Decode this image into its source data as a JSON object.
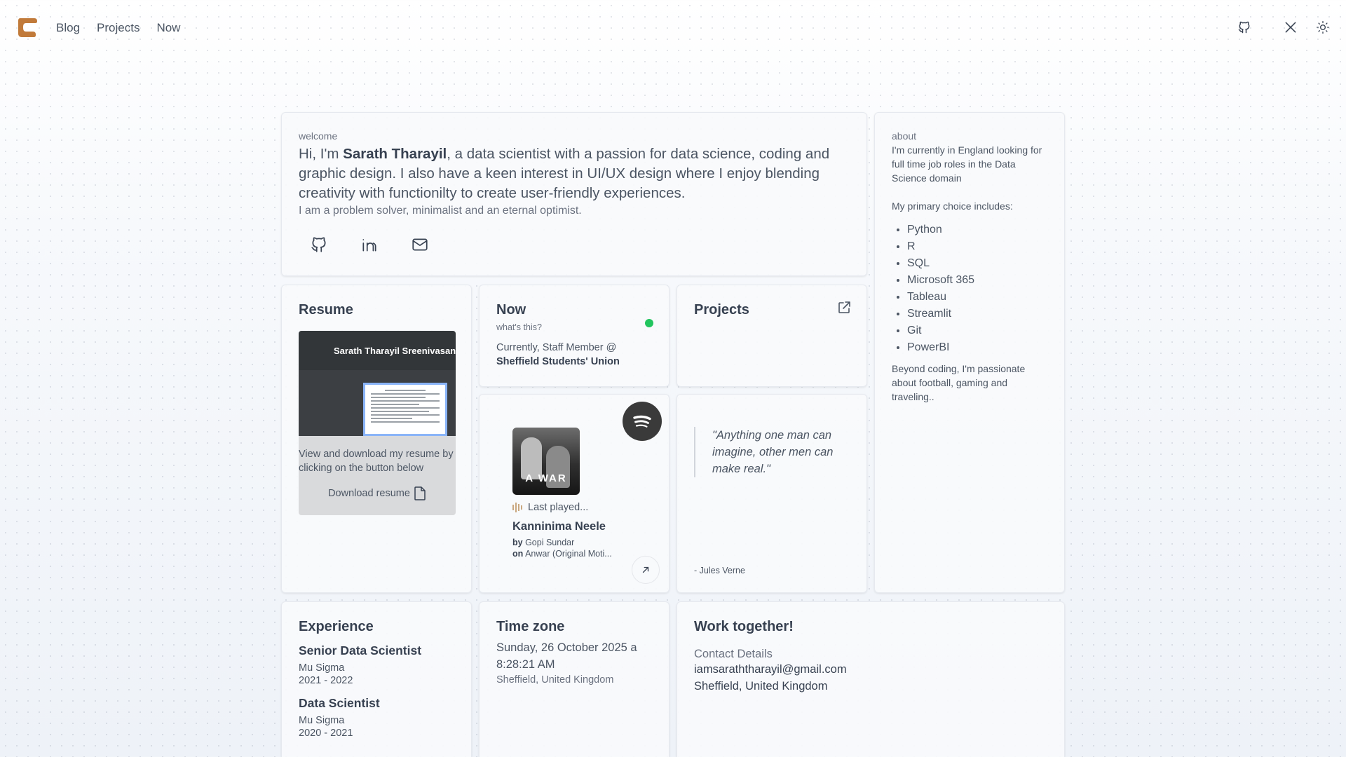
{
  "nav": {
    "links": [
      "Blog",
      "Projects",
      "Now"
    ],
    "icons": [
      "github-icon",
      "x-icon",
      "sun-icon"
    ]
  },
  "welcome": {
    "label": "welcome",
    "intro_prefix": "Hi, I'm ",
    "name": "Sarath Tharayil",
    "intro_rest": ", a data scientist with a passion for data science, coding and graphic design. I also have a keen interest in UI/UX design where I enjoy blending creativity with functionilty to create user-friendly experiences.",
    "tagline": "I am a problem solver, minimalist and an eternal optimist.",
    "icons": [
      "github-icon",
      "linkedin-icon",
      "mail-icon"
    ]
  },
  "about": {
    "label": "about",
    "text": "I'm currently in England looking for full time job roles in the Data Science domain",
    "choice_label": "My primary choice includes:",
    "skills": [
      "Python",
      "R",
      "SQL",
      "Microsoft 365",
      "Tableau",
      "Streamlit",
      "Git",
      "PowerBI"
    ],
    "outro": "Beyond coding, I'm passionate about football, gaming and traveling.."
  },
  "resume": {
    "title": "Resume",
    "viewer_filename": "Sarath Tharayil Sreenivasan",
    "description": "View and download my resume by clicking on the button below",
    "download_label": "Download resume"
  },
  "now": {
    "title": "Now",
    "link": "what's this?",
    "status_prefix": "Currently, Staff Member @",
    "status_org": "Sheffield Students' Union",
    "status_color": "#22c55e"
  },
  "projects": {
    "title": "Projects"
  },
  "spotify": {
    "album_text": "A WAR",
    "last_played": "Last played...",
    "track": "Kanninima Neele",
    "by_label": "by",
    "artist": "Gopi Sundar",
    "on_label": "on",
    "album": "Anwar (Original Moti..."
  },
  "quote": {
    "text": "\"Anything one man can imagine, other men can make real.\"",
    "author": "- Jules Verne"
  },
  "experience": {
    "title": "Experience",
    "jobs": [
      {
        "role": "Senior Data Scientist",
        "company": "Mu Sigma",
        "years": "2021 - 2022"
      },
      {
        "role": "Data Scientist",
        "company": "Mu Sigma",
        "years": "2020 - 2021"
      }
    ]
  },
  "timezone": {
    "title": "Time zone",
    "datetime": "Sunday, 26 October 2025 a 8:28:21 AM",
    "location": "Sheffield, United Kingdom"
  },
  "work": {
    "title": "Work together!",
    "contact_label": "Contact Details",
    "email": "iamsaraththarayil@gmail.com",
    "location": "Sheffield, United Kingdom"
  },
  "colors": {
    "logo": "#c17a3a",
    "spotify_bg": "#3a3a3a"
  }
}
